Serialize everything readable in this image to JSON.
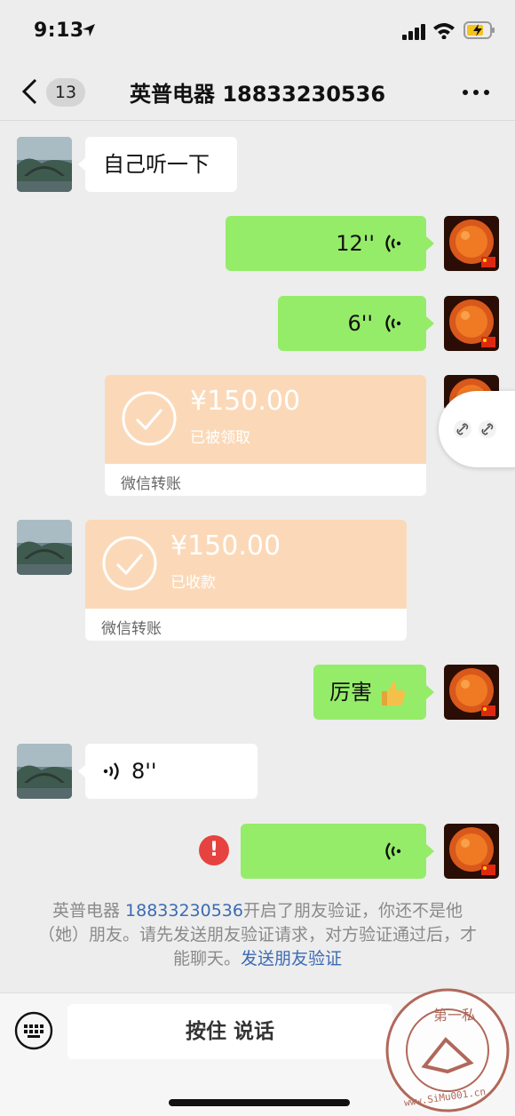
{
  "status_bar": {
    "time": "9:13"
  },
  "nav": {
    "unread_count": "13",
    "title": "英普电器 18833230536"
  },
  "messages": [
    {
      "id": "m1",
      "text": "自己听一下"
    },
    {
      "id": "m2",
      "duration": "12''"
    },
    {
      "id": "m3",
      "duration": "6''"
    },
    {
      "id": "m4",
      "amount": "¥150.00",
      "status": "已被领取",
      "footer": "微信转账"
    },
    {
      "id": "m5",
      "amount": "¥150.00",
      "status": "已收款",
      "footer": "微信转账"
    },
    {
      "id": "m6",
      "text": "厉害"
    },
    {
      "id": "m7",
      "duration": "8''"
    },
    {
      "id": "m8",
      "duration": ""
    }
  ],
  "notice": {
    "name": "英普电器 ",
    "phone": "18833230536",
    "text": "开启了朋友验证，你还不是他（她）朋友。请先发送朋友验证请求，对方验证通过后，才能聊天。",
    "link": "发送朋友验证"
  },
  "input_bar": {
    "press_to_talk": "按住 说话"
  },
  "watermark": {
    "text": "第一私",
    "url": "www.SiMu001.cn"
  },
  "colors": {
    "green_bubble": "#95ec69",
    "transfer": "#fbd9b8",
    "link": "#3b6bb3",
    "error": "#e64340"
  },
  "icons": [
    "location-arrow-icon",
    "signal-icon",
    "wifi-icon",
    "battery-icon",
    "back-icon",
    "more-icon",
    "voice-icon",
    "check-icon",
    "thumbs-up-icon",
    "link-icon",
    "keyboard-icon",
    "error-icon"
  ]
}
